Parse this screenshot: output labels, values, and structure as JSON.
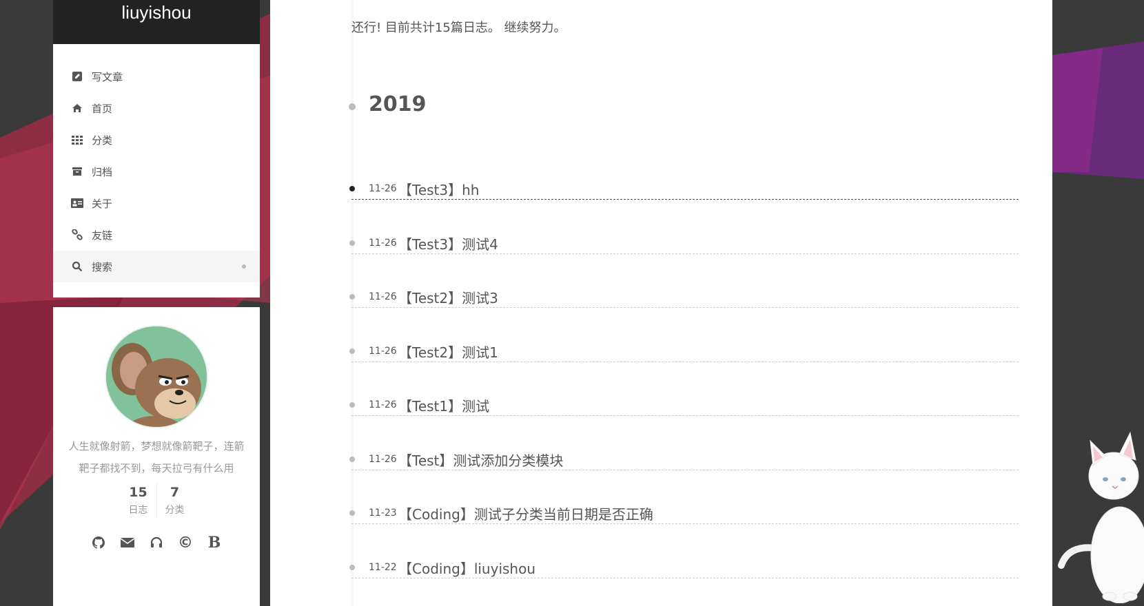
{
  "site": {
    "title": "liuyishou"
  },
  "menu": {
    "items": [
      {
        "label": "写文章",
        "icon": "edit-icon"
      },
      {
        "label": "首页",
        "icon": "home-icon"
      },
      {
        "label": "分类",
        "icon": "grid-icon"
      },
      {
        "label": "归档",
        "icon": "archive-icon"
      },
      {
        "label": "关于",
        "icon": "id-card-icon"
      },
      {
        "label": "友链",
        "icon": "link-icon"
      },
      {
        "label": "搜索",
        "icon": "search-icon"
      }
    ]
  },
  "profile": {
    "bio": "人生就像射箭，梦想就像箭靶子，连箭靶子都找不到，每天拉弓有什么用",
    "stats": [
      {
        "num": "15",
        "label": "日志"
      },
      {
        "num": "7",
        "label": "分类"
      }
    ],
    "socials": [
      "github-icon",
      "mail-icon",
      "headphones-icon",
      "copyright-icon",
      "bold-b-icon"
    ],
    "copyright_glyph": "©",
    "b_glyph": "B"
  },
  "archive": {
    "intro": "还行! 目前共计15篇日志。 继续努力。",
    "year": "2019",
    "posts": [
      {
        "date": "11-26",
        "title": "【Test3】hh"
      },
      {
        "date": "11-26",
        "title": "【Test3】测试4"
      },
      {
        "date": "11-26",
        "title": "【Test2】测试3"
      },
      {
        "date": "11-26",
        "title": "【Test2】测试1"
      },
      {
        "date": "11-26",
        "title": "【Test1】测试"
      },
      {
        "date": "11-26",
        "title": "【Test】测试添加分类模块"
      },
      {
        "date": "11-23",
        "title": "【Coding】测试子分类当前日期是否正确"
      },
      {
        "date": "11-22",
        "title": "【Coding】liuyishou"
      }
    ]
  },
  "colors": {
    "background": "#3a3a3a",
    "brand_bg": "#222222",
    "accent_red": "#b0304a",
    "accent_purple": "#7a2a8a"
  }
}
